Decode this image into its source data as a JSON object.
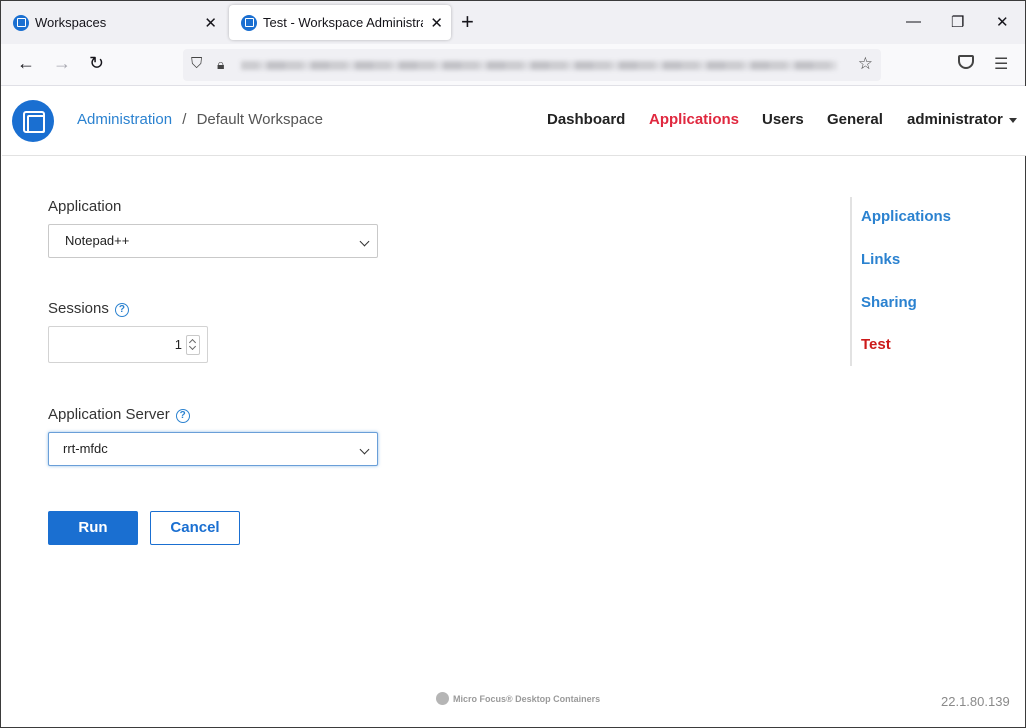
{
  "browser": {
    "tabs": [
      {
        "title": "Workspaces",
        "active": false
      },
      {
        "title": "Test - Workspace Administratio",
        "active": true
      }
    ],
    "icons": {
      "back": "arrow-left-icon",
      "forward": "arrow-right-icon",
      "reload": "reload-icon",
      "new_tab": "plus-icon",
      "bookmark": "star-icon",
      "pocket": "pocket-icon",
      "menu": "hamburger-icon"
    }
  },
  "header": {
    "breadcrumb": {
      "root": "Administration",
      "separator": "/",
      "current": "Default Workspace"
    },
    "nav": [
      {
        "label": "Dashboard",
        "active": false
      },
      {
        "label": "Applications",
        "active": true
      },
      {
        "label": "Users",
        "active": false
      },
      {
        "label": "General",
        "active": false
      }
    ],
    "user": "administrator",
    "accent_color": "#e0283f",
    "brand_color": "#1a6fd1"
  },
  "form": {
    "application_label": "Application",
    "application_value": "Notepad++",
    "sessions_label": "Sessions",
    "sessions_value": "1",
    "server_label": "Application Server",
    "server_value": "rrt-mfdc",
    "run_label": "Run",
    "cancel_label": "Cancel",
    "help_glyph": "?"
  },
  "sidebar": {
    "items": [
      {
        "label": "Applications",
        "active": false
      },
      {
        "label": "Links",
        "active": false
      },
      {
        "label": "Sharing",
        "active": false
      },
      {
        "label": "Test",
        "active": true
      }
    ]
  },
  "footer": {
    "brand": "Micro Focus® Desktop Containers",
    "version": "22.1.80.139"
  }
}
